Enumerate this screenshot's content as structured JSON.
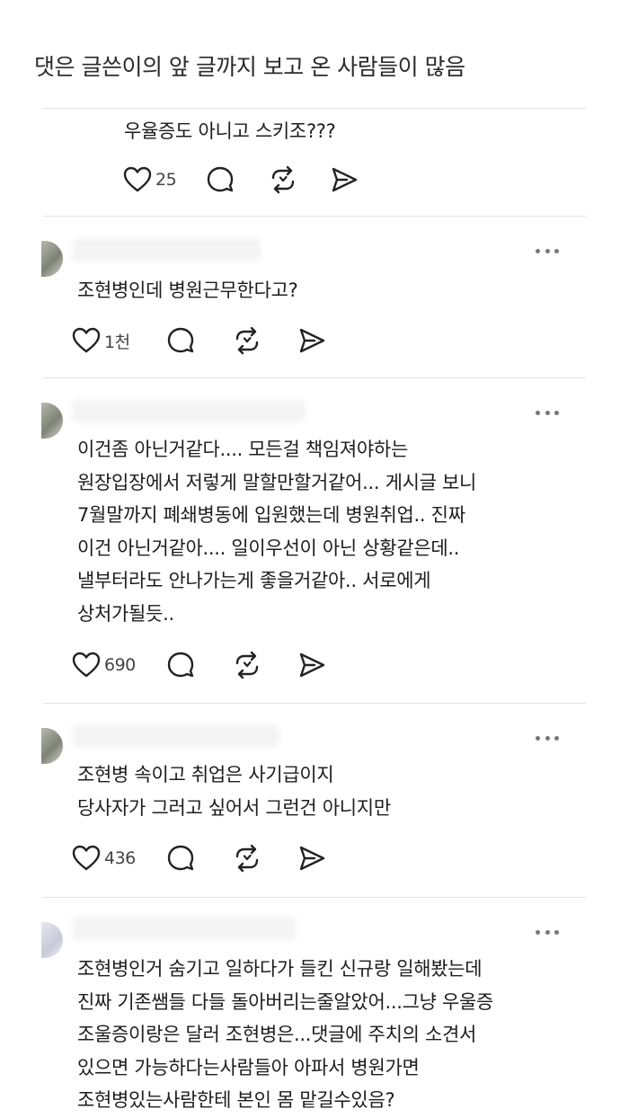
{
  "caption": "댓은 글쓴이의 앞 글까지 보고 온 사람들이 많음",
  "posts": [
    {
      "lines": [
        "우율증도 아니고 스키조???"
      ],
      "likes": "25"
    },
    {
      "lines": [
        "조현병인데 병원근무한다고?"
      ],
      "likes": "1천"
    },
    {
      "lines": [
        "이건좀 아닌거같다.... 모든걸 책임져야하는",
        "원장입장에서 저렇게 말할만할거같어... 게시글 보니",
        "7월말까지 폐쇄병동에 입원했는데 병원취업.. 진짜",
        "이건 아닌거같아.... 일이우선이 아닌 상황같은데..",
        "낼부터라도 안나가는게 좋을거같아.. 서로에게",
        "상처가될듯.."
      ],
      "likes": "690"
    },
    {
      "lines": [
        "조현병 속이고 취업은 사기급이지",
        "당사자가 그러고 싶어서 그런건 아니지만"
      ],
      "likes": "436"
    },
    {
      "lines": [
        "조현병인거 숨기고 일하다가 들킨 신규랑 일해봤는데",
        "진짜 기존쌤들 다들 돌아버리는줄알았어...그냥 우울증",
        "조울증이랑은 달러 조현병은...댓글에 주치의 소견서",
        "있으면 가능하다는사람들아 아파서 병원가면",
        "조현병있는사람한테 본인 몸 맡길수있음?"
      ]
    }
  ],
  "icons": [
    "heart-icon",
    "comment-icon",
    "repost-icon",
    "share-icon",
    "more-icon"
  ]
}
